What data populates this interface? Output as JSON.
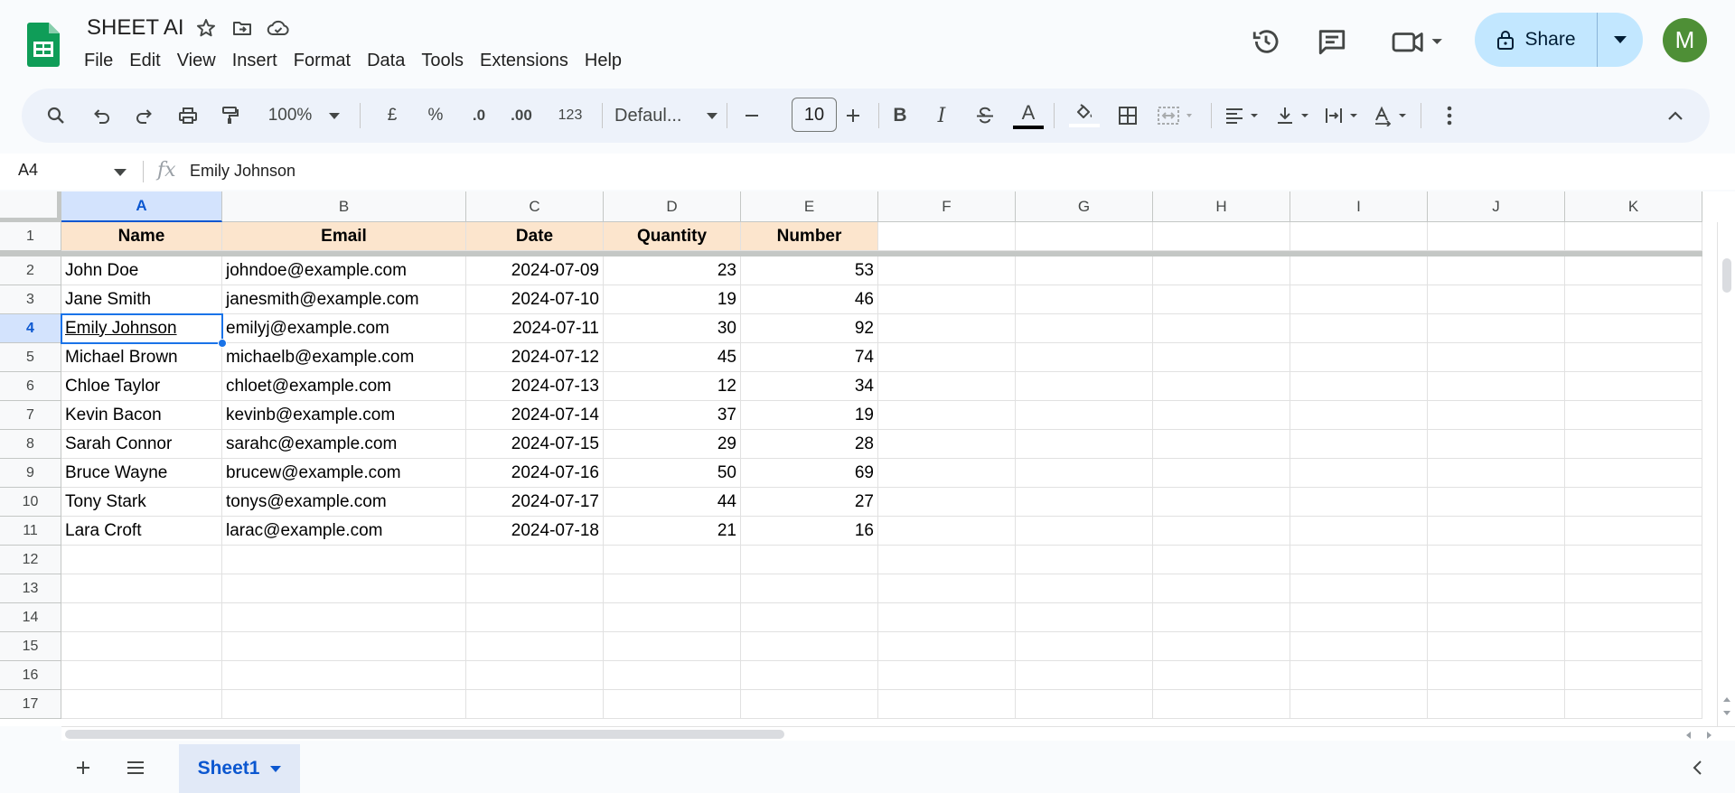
{
  "app": {
    "title": "SHEET AI",
    "avatar_letter": "M",
    "share_label": "Share",
    "accent": "#0b57d0",
    "brand_green": "#0f9d58"
  },
  "menu": [
    "File",
    "Edit",
    "View",
    "Insert",
    "Format",
    "Data",
    "Tools",
    "Extensions",
    "Help"
  ],
  "toolbar": {
    "zoom": "100%",
    "currency": "£",
    "percent": "%",
    "decrease_decimal": ".0",
    "increase_decimal": ".00",
    "number_format": "123",
    "font": "Defaul...",
    "font_size": "10",
    "bold": "B",
    "italic": "I",
    "text_color": "A"
  },
  "formula_bar": {
    "cell_ref": "A4",
    "fx": "fx",
    "content": "Emily Johnson"
  },
  "columns": [
    "A",
    "B",
    "C",
    "D",
    "E",
    "F",
    "G",
    "H",
    "I",
    "J",
    "K"
  ],
  "row_numbers": [
    "1",
    "2",
    "3",
    "4",
    "5",
    "6",
    "7",
    "8",
    "9",
    "10",
    "11",
    "12",
    "13",
    "14",
    "15",
    "16",
    "17"
  ],
  "headers": [
    "Name",
    "Email",
    "Date",
    "Quantity",
    "Number"
  ],
  "rows": [
    [
      "John Doe",
      "johndoe@example.com",
      "2024-07-09",
      "23",
      "53"
    ],
    [
      "Jane Smith",
      "janesmith@example.com",
      "2024-07-10",
      "19",
      "46"
    ],
    [
      "Emily Johnson",
      "emilyj@example.com",
      "2024-07-11",
      "30",
      "92"
    ],
    [
      "Michael Brown",
      "michaelb@example.com",
      "2024-07-12",
      "45",
      "74"
    ],
    [
      "Chloe Taylor",
      "chloet@example.com",
      "2024-07-13",
      "12",
      "34"
    ],
    [
      "Kevin Bacon",
      "kevinb@example.com",
      "2024-07-14",
      "37",
      "19"
    ],
    [
      "Sarah Connor",
      "sarahc@example.com",
      "2024-07-15",
      "29",
      "28"
    ],
    [
      "Bruce Wayne",
      "brucew@example.com",
      "2024-07-16",
      "50",
      "69"
    ],
    [
      "Tony Stark",
      "tonys@example.com",
      "2024-07-17",
      "44",
      "27"
    ],
    [
      "Lara Croft",
      "larac@example.com",
      "2024-07-18",
      "21",
      "16"
    ]
  ],
  "sheet_tab": "Sheet1"
}
